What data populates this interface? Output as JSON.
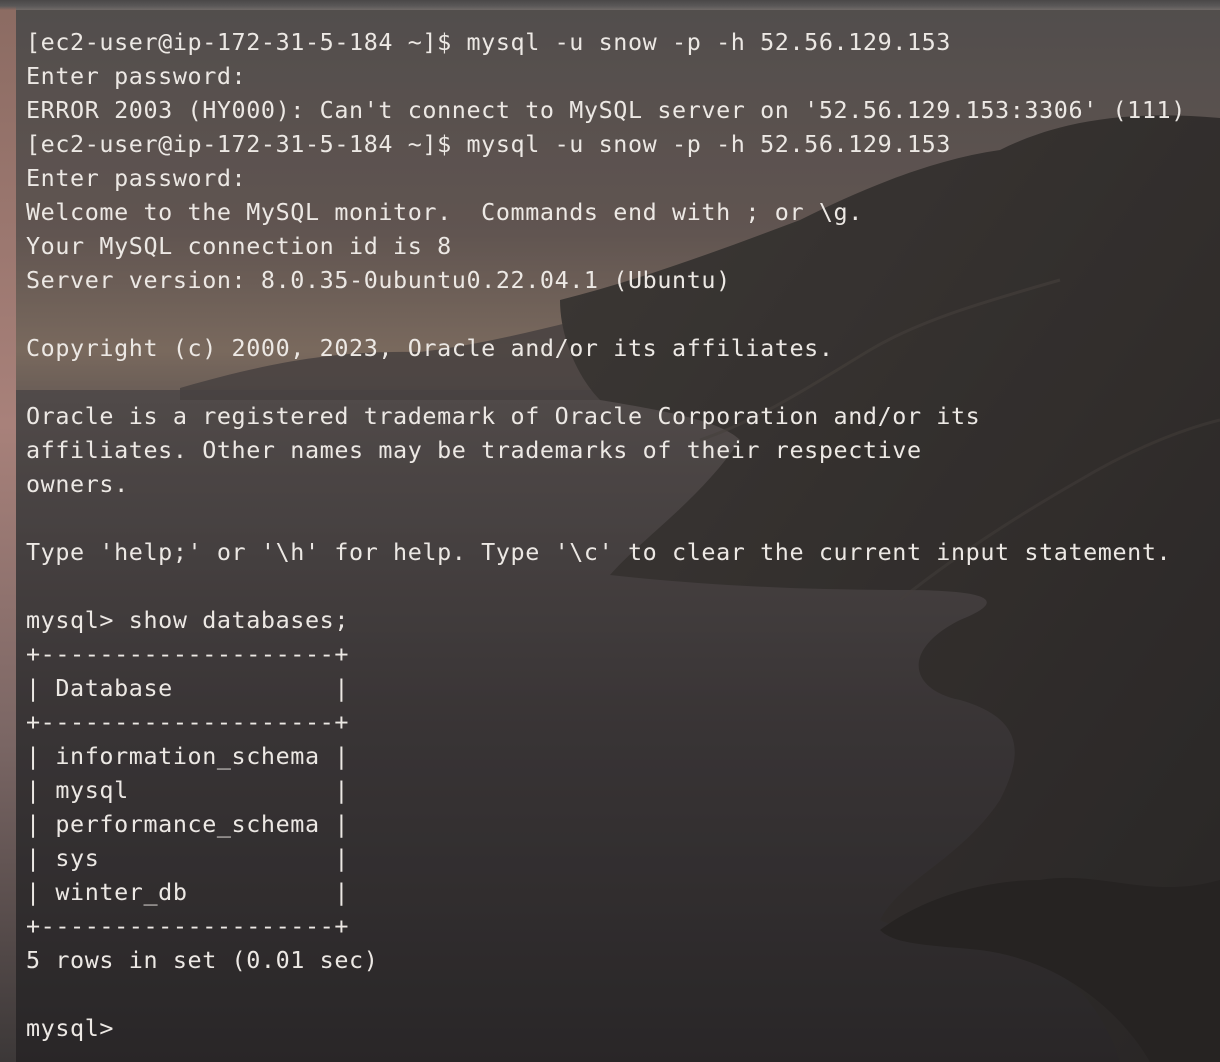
{
  "window": {
    "type": "terminal",
    "background": "coastal cliffs at sunset wallpaper"
  },
  "colors": {
    "text": "#ece8e4",
    "terminal_bg": "#282626"
  },
  "terminal": {
    "lines": [
      "[ec2-user@ip-172-31-5-184 ~]$ mysql -u snow -p -h 52.56.129.153",
      "Enter password:",
      "ERROR 2003 (HY000): Can't connect to MySQL server on '52.56.129.153:3306' (111)",
      "[ec2-user@ip-172-31-5-184 ~]$ mysql -u snow -p -h 52.56.129.153",
      "Enter password:",
      "Welcome to the MySQL monitor.  Commands end with ; or \\g.",
      "Your MySQL connection id is 8",
      "Server version: 8.0.35-0ubuntu0.22.04.1 (Ubuntu)",
      "",
      "Copyright (c) 2000, 2023, Oracle and/or its affiliates.",
      "",
      "Oracle is a registered trademark of Oracle Corporation and/or its",
      "affiliates. Other names may be trademarks of their respective",
      "owners.",
      "",
      "Type 'help;' or '\\h' for help. Type '\\c' to clear the current input statement.",
      "",
      "mysql> show databases;",
      "+--------------------+",
      "| Database           |",
      "+--------------------+",
      "| information_schema |",
      "| mysql              |",
      "| performance_schema |",
      "| sys                |",
      "| winter_db          |",
      "+--------------------+",
      "5 rows in set (0.01 sec)",
      "",
      "mysql>"
    ]
  }
}
